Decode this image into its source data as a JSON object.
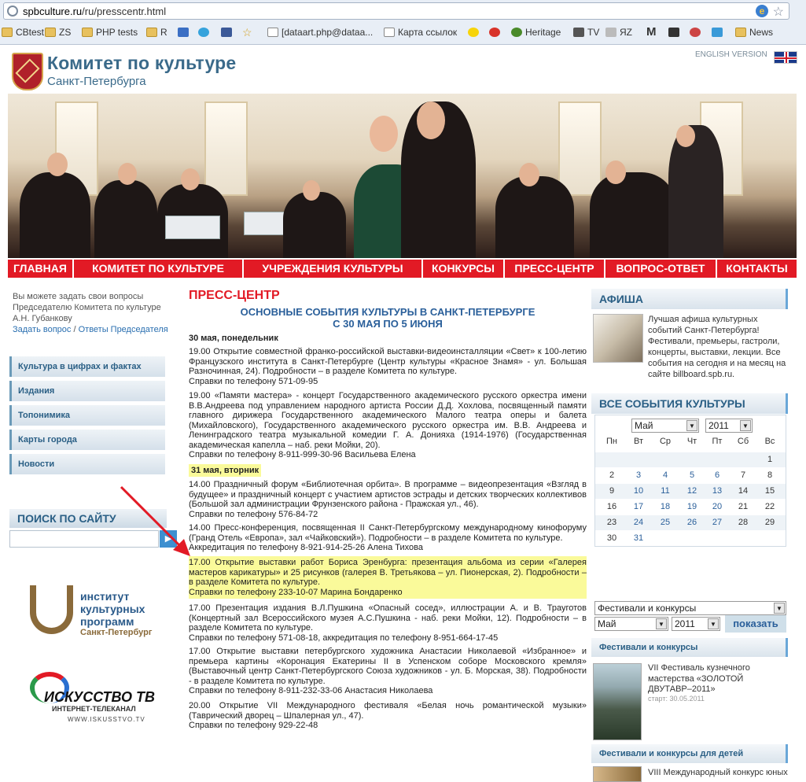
{
  "browser": {
    "url_domain": "spbculture.ru",
    "url_path": "/ru/presscentr.html",
    "bookmarks": [
      {
        "label": "CBtest",
        "icon": "folder-icon"
      },
      {
        "label": "ZS",
        "icon": "folder-icon"
      },
      {
        "label": "PHP tests",
        "icon": "folder-icon"
      },
      {
        "label": "R",
        "icon": "folder-icon"
      },
      {
        "label": "",
        "icon": "ff-icon"
      },
      {
        "label": "",
        "icon": "twitter-icon"
      },
      {
        "label": "",
        "icon": "facebook-icon"
      },
      {
        "label": "",
        "icon": "star-icon"
      },
      {
        "label": "[dataart.php@dataa...",
        "icon": "page-icon"
      },
      {
        "label": "Карта ссылок",
        "icon": "page-icon"
      },
      {
        "label": "",
        "icon": "pacman-icon"
      },
      {
        "label": "",
        "icon": "tomato-icon"
      },
      {
        "label": "Heritage",
        "icon": "heritage-icon"
      },
      {
        "label": "TV",
        "icon": "tv-icon"
      },
      {
        "label": "ЯZ",
        "icon": "yz-icon"
      },
      {
        "label": "",
        "icon": "m-icon"
      },
      {
        "label": "",
        "icon": "car-icon"
      },
      {
        "label": "",
        "icon": "wheel-icon"
      },
      {
        "label": "",
        "icon": "wave-icon"
      },
      {
        "label": "News",
        "icon": "folder-icon"
      }
    ]
  },
  "header": {
    "title": "Комитет по культуре",
    "subtitle": "Санкт-Петербурга",
    "english_link": "ENGLISH VERSION"
  },
  "nav": [
    "ГЛАВНАЯ",
    "КОМИТЕТ ПО КУЛЬТУРЕ",
    "УЧРЕЖДЕНИЯ КУЛЬТУРЫ",
    "КОНКУРСЫ",
    "ПРЕСС-ЦЕНТР",
    "ВОПРОС-ОТВЕТ",
    "КОНТАКТЫ"
  ],
  "left": {
    "ask_line1": "Вы можете задать свои вопросы",
    "ask_line2": "Председателю Комитета по культуре",
    "ask_line3": "А.Н. Губанкову",
    "ask_link": "Задать вопрос",
    "sep": " / ",
    "answers_link": "Ответы Председателя",
    "menu": [
      "Культура в цифрах и фактах",
      "Издания",
      "Топонимика",
      "Карты города",
      "Новости"
    ],
    "search_title": "ПОИСК ПО САЙТУ",
    "search_value": "",
    "ikp_title_1": "институт",
    "ikp_title_2": "культурных",
    "ikp_title_3": "программ",
    "ikp_city": "Санкт-Петербург",
    "itv_title": "ИСКУССТВО ТВ",
    "itv_sub": "ИНТЕРНЕТ-ТЕЛЕКАНАЛ",
    "itv_url": "WWW.ISKUSSTVO.TV"
  },
  "main": {
    "section_title": "ПРЕСС-ЦЕНТР",
    "events_title_1": "ОСНОВНЫЕ СОБЫТИЯ КУЛЬТУРЫ В САНКТ-ПЕТЕРБУРГЕ",
    "events_title_2": "С 30 МАЯ ПО 5 ИЮНЯ",
    "day1": "30 мая, понедельник",
    "e1": "19.00 Открытие совместной франко-российской выставки-видеоинсталляции «Свет» к 100-летию Французского института в Санкт-Петербурге (Центр культуры «Красное Знамя» - ул. Большая Разночинная, 24). Подробности – в разделе Комитета по культуре.",
    "e1_phone": "Справки по телефону 571-09-95",
    "e2": "19.00 «Памяти мастера» - концерт Государственного академического русского оркестра имени В.В.Андреева под управлением народного артиста России Д.Д. Хохлова, посвященный памяти главного дирижера Государственного академического Малого театра оперы и балета (Михайловского), Государственного академического русского оркестра им. В.В. Андреева и Ленинградского театра музыкальной комедии Г. А. Донияха  (1914-1976) (Государственная академическая капелла – наб. реки Мойки, 20).",
    "e2_phone": "Справки по телефону 8-911-999-30-96 Васильева Елена",
    "day2": "31 мая, вторник",
    "e3": "14.00 Праздничный форум «Библиотечная орбита». В программе – видеопрезентация «Взгляд в будущее» и праздничный концерт с участием артистов эстрады и детских творческих коллективов (Большой зал администрации Фрунзенского района  - Пражская ул., 46).",
    "e3_phone": "Справки по телефону 576-84-72",
    "e4": "14.00 Пресс-конференция, посвященная II Санкт-Петербургскому международному кинофоруму (Гранд Отель «Европа», зал «Чайковский»). Подробности – в разделе Комитета по культуре.",
    "e4_phone": "Аккредитация по телефону 8-921-914-25-26 Алена Тихова",
    "e5": "17.00 Открытие выставки работ Бориса Эренбурга: презентация альбома из серии «Галерея мастеров карикатуры» и 25 рисунков (галерея В. Третьякова – ул. Пионерская, 2). Подробности – в разделе Комитета по культуре.",
    "e5_phone": "Справки по телефону 233-10-07 Марина Бондаренко",
    "e6": "17.00 Презентация издания В.Л.Пушкина «Опасный сосед», иллюстрации А. и В. Трауготов (Концертный зал Всероссийского музея А.С.Пушкина - наб. реки Мойки, 12). Подробности – в разделе Комитета по культуре.",
    "e6_phone": "Справки по телефону 571-08-18, аккредитация по телефону 8-951-664-17-45",
    "e7": "17.00 Открытие выставки петербургского художника Анастасии Николаевой «Избранное» и премьера картины «Коронация Екатерины II в Успенском соборе Московского кремля» (Выставочный центр Санкт-Петербургского Союза художников -   ул. Б. Морская, 38). Подробности - в разделе Комитета по культуре.",
    "e7_phone": "Справки по телефону 8-911-232-33-06 Анастасия Николаева",
    "e8": "20.00    Открытие VII Международного фестиваля «Белая ночь романтической музыки» (Таврический дворец – Шпалерная ул., 47).",
    "e8_phone": "Справки по телефону 929-22-48"
  },
  "right": {
    "afisha_title": "АФИША",
    "afisha_text": "Лучшая афиша культурных событий Санкт-Петербурга! Фестивали, премьеры, гастроли, концерты, выставки, лекции. Все события на сегодня и на месяц на сайте billboard.spb.ru.",
    "all_events_title": "ВСЕ СОБЫТИЯ КУЛЬТУРЫ",
    "month": "Май",
    "year": "2011",
    "weekdays": [
      "Пн",
      "Вт",
      "Ср",
      "Чт",
      "Пт",
      "Сб",
      "Вс"
    ],
    "weeks": [
      [
        "",
        "",
        "",
        "",
        "",
        "",
        "1"
      ],
      [
        "2",
        "3",
        "4",
        "5",
        "6",
        "7",
        "8"
      ],
      [
        "9",
        "10",
        "11",
        "12",
        "13",
        "14",
        "15"
      ],
      [
        "16",
        "17",
        "18",
        "19",
        "20",
        "21",
        "22"
      ],
      [
        "23",
        "24",
        "25",
        "26",
        "27",
        "28",
        "29"
      ],
      [
        "30",
        "31",
        "",
        "",
        "",
        "",
        ""
      ]
    ],
    "filter_category": "Фестивали и конкурсы",
    "filter_month": "Май",
    "filter_year": "2011",
    "show_button": "показать",
    "fest_title": "Фестивали и конкурсы",
    "fest_item": "VII Фестиваль кузнечного мастерства «ЗОЛОТОЙ ДВУТАВР–2011»",
    "fest_date": "старт: 30.05.2011",
    "kids_title": "Фестивали и конкурсы для детей",
    "kids_item": "VIII Международный конкурс юных"
  },
  "colors": {
    "accent_red": "#e21a25",
    "link_blue": "#2a6fb0",
    "highlight_yellow": "#fafa9a"
  }
}
